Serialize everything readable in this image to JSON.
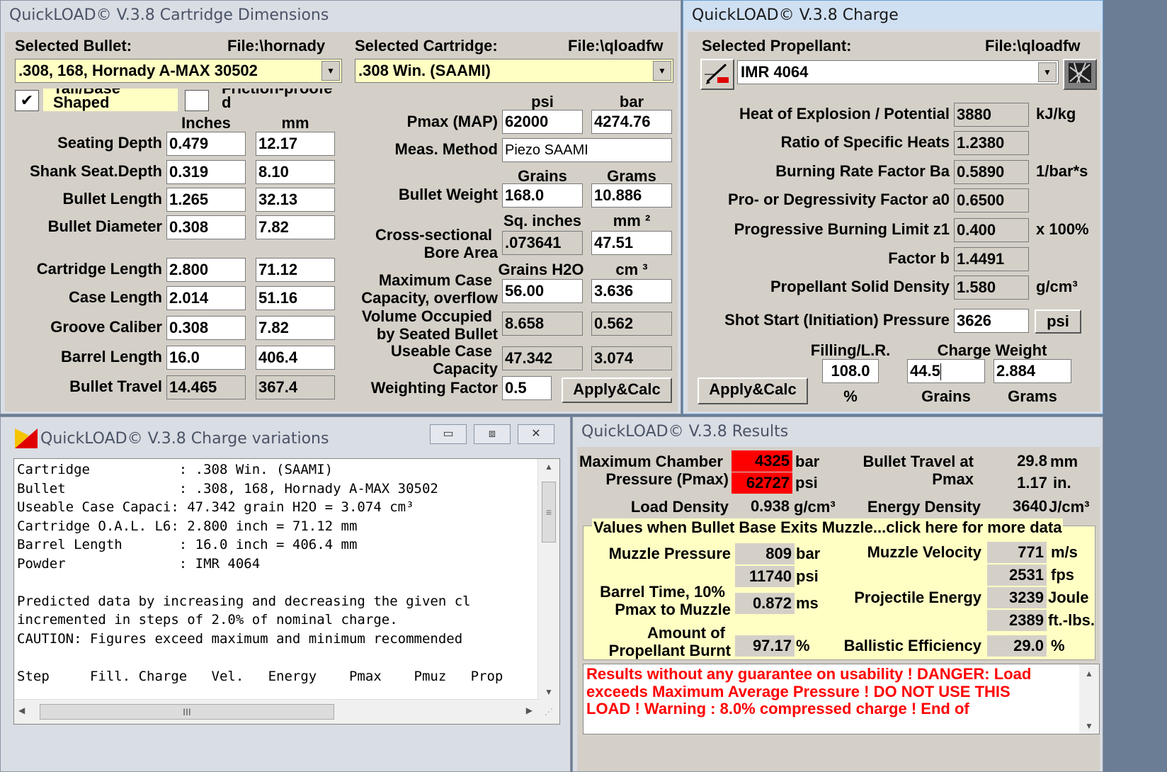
{
  "dims": {
    "title": "QuickLOAD© V.3.8 Cartridge Dimensions",
    "bullet_label": "Selected Bullet:",
    "bullet_file": "File:\\hornady",
    "bullet_value": ".308, 168, Hornady A-MAX 30502",
    "cartridge_label": "Selected Cartridge:",
    "cartridge_file": "File:\\qloadfw",
    "cartridge_value": ".308 Win. (SAAMI)",
    "tail_label": "Tail/Base Shaped",
    "tail_checked": "✔",
    "friction_label": "Friction-proofed",
    "col_inches": "Inches",
    "col_mm": "mm",
    "rows1": [
      {
        "label": "Seating Depth",
        "in": "0.479",
        "mm": "12.17"
      },
      {
        "label": "Shank Seat.Depth",
        "in": "0.319",
        "mm": "8.10"
      },
      {
        "label": "Bullet Length",
        "in": "1.265",
        "mm": "32.13"
      },
      {
        "label": "Bullet Diameter",
        "in": "0.308",
        "mm": "7.82"
      }
    ],
    "rows2": [
      {
        "label": "Cartridge Length",
        "in": "2.800",
        "mm": "71.12"
      },
      {
        "label": "Case Length",
        "in": "2.014",
        "mm": "51.16"
      },
      {
        "label": "Groove Caliber",
        "in": "0.308",
        "mm": "7.82"
      },
      {
        "label": "Barrel Length",
        "in": "16.0",
        "mm": "406.4"
      },
      {
        "label": "Bullet Travel",
        "in": "14.465",
        "mm": "367.4"
      }
    ],
    "col_psi": "psi",
    "col_bar": "bar",
    "pmax_label": "Pmax (MAP)",
    "pmax_psi": "62000",
    "pmax_bar": "4274.76",
    "meas_label": "Meas. Method",
    "meas_value": "Piezo SAAMI",
    "col_grains": "Grains",
    "col_grams": "Grams",
    "bw_label": "Bullet Weight",
    "bw_grains": "168.0",
    "bw_grams": "10.886",
    "col_sqin": "Sq. inches",
    "col_mm2": "mm ²",
    "cs_label1": "Cross-sectional",
    "cs_label2": "Bore Area",
    "cs_sqin": ".073641",
    "cs_mm2": "47.51",
    "col_grh2o": "Grains H2O",
    "col_cm3": "cm ³",
    "mcc_label1": "Maximum Case",
    "mcc_label2": "Capacity, overflow",
    "mcc_gr": "56.00",
    "mcc_cm3": "3.636",
    "vo_label1": "Volume Occupied",
    "vo_label2": "by Seated Bullet",
    "vo_gr": "8.658",
    "vo_cm3": "0.562",
    "uc_label1": "Useable Case",
    "uc_label2": "Capacity",
    "uc_gr": "47.342",
    "uc_cm3": "3.074",
    "wf_label": "Weighting Factor",
    "wf_value": "0.5",
    "apply": "Apply&Calc"
  },
  "charge": {
    "title": "QuickLOAD© V.3.8 Charge",
    "prop_label": "Selected Propellant:",
    "prop_file": "File:\\qloadfw",
    "prop_value": "IMR 4064",
    "rows": [
      {
        "label": "Heat of Explosion / Potential",
        "value": "3880",
        "unit": "kJ/kg"
      },
      {
        "label": "Ratio of Specific Heats",
        "value": "1.2380",
        "unit": ""
      },
      {
        "label": "Burning Rate Factor  Ba",
        "value": "0.5890",
        "unit": "1/bar*s"
      },
      {
        "label": "Pro- or Degressivity Factor  a0",
        "value": "0.6500",
        "unit": ""
      },
      {
        "label": "Progressive Burning Limit z1",
        "value": "0.400",
        "unit": "x 100%"
      },
      {
        "label": "Factor  b",
        "value": "1.4491",
        "unit": ""
      },
      {
        "label": "Propellant Solid Density",
        "value": "1.580",
        "unit": "g/cm³"
      }
    ],
    "shot_label": "Shot Start (Initiation) Pressure",
    "shot_value": "3626",
    "shot_unit": "psi",
    "filling_label": "Filling/L.R.",
    "cw_label": "Charge Weight",
    "filling_value": "108.0",
    "cw_grains": "44.5",
    "cw_grams": "2.884",
    "pct": "%",
    "grains": "Grains",
    "grams": "Grams",
    "apply": "Apply&Calc"
  },
  "variations": {
    "title": "QuickLOAD© V.3.8 Charge variations",
    "lines": [
      "Cartridge           : .308 Win. (SAAMI)",
      "Bullet              : .308, 168, Hornady A-MAX 30502",
      "Useable Case Capaci: 47.342 grain H2O = 3.074 cm³",
      "Cartridge O.A.L. L6: 2.800 inch = 71.12 mm",
      "Barrel Length       : 16.0 inch = 406.4 mm",
      "Powder              : IMR 4064",
      "",
      "Predicted data by increasing and decreasing the given cl",
      "incremented in steps of 2.0% of nominal charge.",
      "CAUTION: Figures exceed maximum and minimum recommended",
      "",
      "Step     Fill. Charge   Vel.   Energy    Pmax    Pmuz   Prop"
    ],
    "hscroll_grip": "III"
  },
  "results": {
    "title": "QuickLOAD© V.3.8 Results",
    "mcp_label1": "Maximum Chamber",
    "mcp_label2": "Pressure (Pmax)",
    "mcp_bar": "4325",
    "mcp_bar_unit": "bar",
    "mcp_psi": "62727",
    "mcp_psi_unit": "psi",
    "bt_label1": "Bullet Travel at",
    "bt_label2": "Pmax",
    "bt_mm": "29.8",
    "bt_mm_unit": "mm",
    "bt_in": "1.17",
    "bt_in_unit": "in.",
    "ld_label": "Load Density",
    "ld_value": "0.938",
    "ld_unit": "g/cm³",
    "ed_label": "Energy Density",
    "ed_value": "3640",
    "ed_unit": "J/cm³",
    "muzzle_header": "Values when Bullet Base Exits Muzzle...click here for more data",
    "mp_label": "Muzzle Pressure",
    "mp_bar": "809",
    "mp_bar_unit": "bar",
    "mp_psi": "11740",
    "mp_psi_unit": "psi",
    "mv_label": "Muzzle Velocity",
    "mv_ms": "771",
    "mv_ms_unit": "m/s",
    "mv_fps": "2531",
    "mv_fps_unit": "fps",
    "btime_label1": "Barrel Time, 10%",
    "btime_label2": "Pmax to Muzzle",
    "btime_value": "0.872",
    "btime_unit": "ms",
    "pe_label": "Projectile Energy",
    "pe_joule": "3239",
    "pe_joule_unit": "Joule",
    "pe_ftlbs": "2389",
    "pe_ftlbs_unit": "ft.-lbs.",
    "apb_label1": "Amount of",
    "apb_label2": "Propellant Burnt",
    "apb_value": "97.17",
    "apb_unit": "%",
    "be_label": "Ballistic Efficiency",
    "be_value": "29.0",
    "be_unit": "%",
    "warning_lines": [
      "Results without any guarantee on usability !  DANGER: Load",
      "exceeds Maximum Average Pressure ! DO NOT USE THIS",
      "LOAD !   Warning : 8.0% compressed charge !  End of"
    ]
  },
  "colors": {
    "accent_red": "#ff0000",
    "field_yellow": "#ffffc4",
    "face": "#d4d0c8"
  }
}
